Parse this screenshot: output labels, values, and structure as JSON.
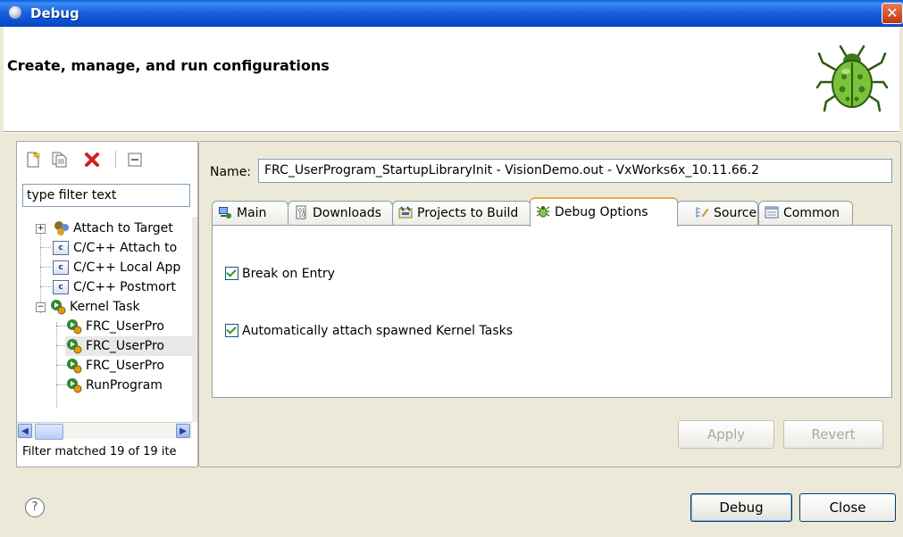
{
  "window": {
    "title": "Debug"
  },
  "header": {
    "title": "Create, manage, and run configurations"
  },
  "filter": {
    "placeholder": "type filter text",
    "value": "type filter text"
  },
  "tree": {
    "items": [
      {
        "label": "Attach to Target",
        "icon": "attach-target-icon",
        "level": 0,
        "expanded": false
      },
      {
        "label": "C/C++ Attach to",
        "icon": "c-icon",
        "level": 0
      },
      {
        "label": "C/C++ Local App",
        "icon": "c-icon",
        "level": 0
      },
      {
        "label": "C/C++ Postmort",
        "icon": "c-icon",
        "level": 0
      },
      {
        "label": "Kernel Task",
        "icon": "kernel-task-icon",
        "level": 0,
        "expanded": true
      },
      {
        "label": "FRC_UserPro",
        "icon": "kernel-task-icon",
        "level": 1
      },
      {
        "label": "FRC_UserPro",
        "icon": "kernel-task-icon",
        "level": 1,
        "selected": true
      },
      {
        "label": "FRC_UserPro",
        "icon": "kernel-task-icon",
        "level": 1
      },
      {
        "label": "RunProgram",
        "icon": "kernel-task-icon",
        "level": 1
      }
    ]
  },
  "filter_status": "Filter matched 19 of 19 ite",
  "config": {
    "name_label": "Name:",
    "name_value": "FRC_UserProgram_StartupLibraryInit - VisionDemo.out - VxWorks6x_10.11.66.2"
  },
  "tabs": [
    {
      "label": "Main",
      "icon": "main-icon"
    },
    {
      "label": "Downloads",
      "icon": "downloads-icon"
    },
    {
      "label": "Projects to Build",
      "icon": "projects-icon"
    },
    {
      "label": "Debug Options",
      "icon": "debug-options-icon",
      "active": true
    },
    {
      "label": "Source",
      "icon": "source-icon"
    },
    {
      "label": "Common",
      "icon": "common-icon"
    }
  ],
  "options": {
    "break_on_entry": {
      "label": "Break on Entry",
      "checked": true
    },
    "auto_attach": {
      "label": "Automatically attach spawned Kernel Tasks",
      "checked": true
    }
  },
  "buttons": {
    "apply": "Apply",
    "revert": "Revert",
    "debug": "Debug",
    "close": "Close",
    "help": "?"
  },
  "colors": {
    "titlebar": "#0a4fd0",
    "active_tab_accent": "#e8a84a",
    "checkmark": "#21a121"
  }
}
